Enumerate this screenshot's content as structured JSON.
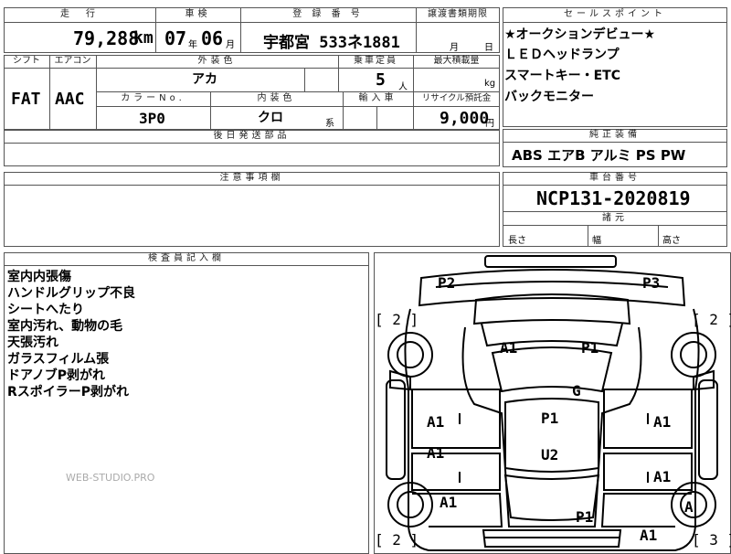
{
  "summary": {
    "headers": {
      "mileage": "走　行",
      "inspection": "車検",
      "registration": "登 録 番 号",
      "transfer_deadline": "譲渡書類期限"
    },
    "mileage_value": "79,288",
    "mileage_unit": "km",
    "inspection_year": "07",
    "inspection_year_unit": "年",
    "inspection_month": "06",
    "inspection_month_unit": "月",
    "registration_value": "宇都宮 533ネ1881",
    "transfer_month_unit": "月",
    "transfer_day_unit": "日"
  },
  "spec": {
    "headers": {
      "shift": "シフト",
      "aircon": "エアコン",
      "exterior_color": "外装色",
      "capacity": "乗車定員",
      "max_load": "最大積載量",
      "color_no": "カラーNo.",
      "interior_color": "内装色",
      "import": "輸入車",
      "recycle": "リサイクル預託金"
    },
    "shift_value": "FAT",
    "aircon_value": "AAC",
    "exterior_color_value": "アカ",
    "capacity_value": "5",
    "capacity_unit": "人",
    "max_load_unit": "kg",
    "color_no_value": "3P0",
    "interior_color_value": "クロ",
    "interior_color_unit": "系",
    "recycle_value": "9,000",
    "recycle_unit": "円",
    "shipping_parts_header": "後日発送部品"
  },
  "notes": {
    "header": "注意事項欄"
  },
  "sales_points": {
    "header": "セールスポイント",
    "items": [
      "★オークションデビュー★",
      "ＬＥＤヘッドランプ",
      "スマートキー・ETC",
      "バックモニター"
    ]
  },
  "genuine_equipment": {
    "header": "純正装備",
    "value": "ABS エアB アルミ PS PW"
  },
  "chassis": {
    "header": "車台番号",
    "value": "NCP131-2020819"
  },
  "dimensions": {
    "header": "諸元",
    "length": "長さ",
    "width": "幅",
    "height": "高さ"
  },
  "inspector": {
    "header": "検査員記入欄",
    "lines": [
      "室内内張傷",
      "ハンドルグリップ不良",
      "シートへたり",
      "室内汚れ、動物の毛",
      "天張汚れ",
      "ガラスフィルム張",
      "ドアノブP剥がれ",
      "RスポイラーP剥がれ"
    ],
    "watermark": "WEB-STUDIO.PRO"
  },
  "diagram": {
    "marks": [
      "P2",
      "P3",
      "[ 2 ]",
      "[ 2 ]",
      "A1",
      "P1",
      "G",
      "A1",
      "P1",
      "A1",
      "A1",
      "U2",
      "A1",
      "A1",
      "A1",
      "P1",
      "A",
      "A1",
      "[ 3 ]",
      "[ 2 ]"
    ]
  }
}
